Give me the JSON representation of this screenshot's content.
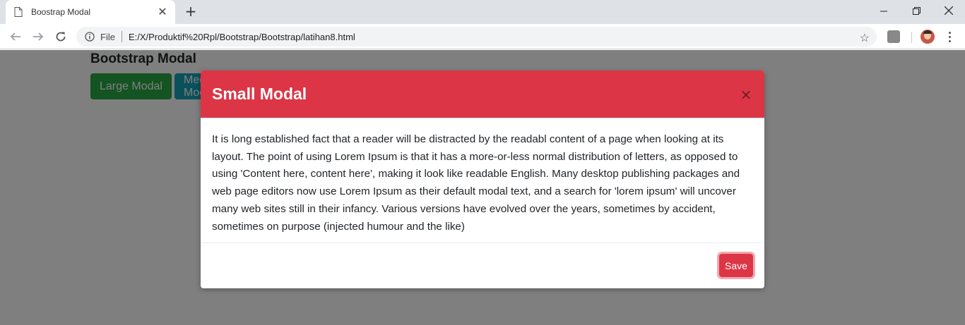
{
  "browser": {
    "tab_title": "Boostrap Modal",
    "tab_close": "✕",
    "new_tab": "+",
    "file_label": "File",
    "url": "E:/X/Produktif%20Rpl/Bootstrap/Bootstrap/latihan8.html"
  },
  "page": {
    "title": "Bootstrap Modal",
    "buttons": {
      "large": "Large Modal",
      "medium": "Medium Modal"
    }
  },
  "modal": {
    "title": "Small Modal",
    "close": "×",
    "body": "It is long established fact that a reader will be distracted by the readabl content of a page when looking at its layout. The point of using Lorem Ipsum is that it has a more-or-less normal distribution of letters, as opposed to using 'Content here, content here', making it look like readable English. Many desktop publishing packages and web page editors now use Lorem Ipsum as their default modal text, and a search for 'lorem ipsum' will uncover many web sites still in their infancy. Various versions have evolved over the years, sometimes by accident, sometimes on purpose (injected humour and the like)",
    "save_label": "Save"
  },
  "colors": {
    "danger": "#dc3545",
    "success": "#28a745",
    "info": "#17a2b8"
  }
}
